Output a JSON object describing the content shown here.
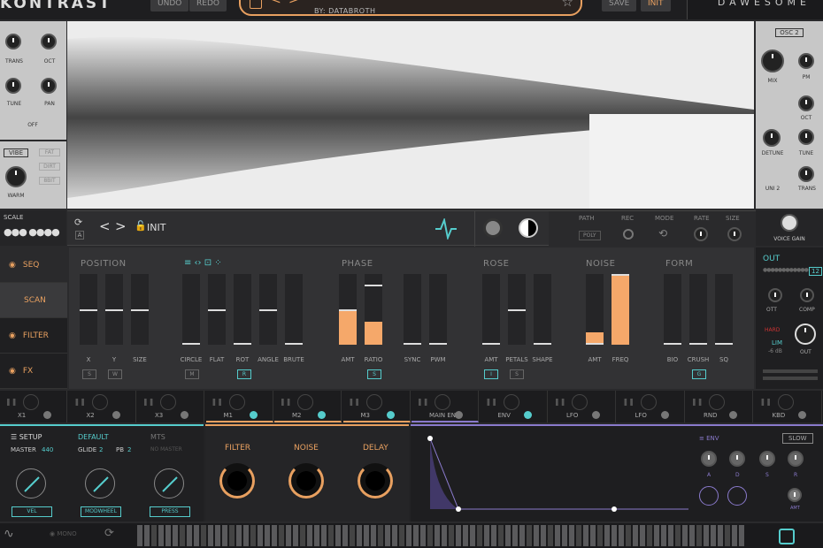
{
  "header": {
    "logo": "KONTRAST",
    "undo": "UNDO",
    "redo": "REDO",
    "preset_by": "BY: DATABROTH",
    "save": "SAVE",
    "init": "INIT",
    "brand": "DAWESOME"
  },
  "left_panel": {
    "trans": "TRANS",
    "oct": "OCT",
    "tune": "TUNE",
    "pan": "PAN",
    "off": "OFF",
    "vibe": "VIBE",
    "fat": "FAT",
    "dirt": "DIRT",
    "bbit": "8BIT",
    "warm": "WARM"
  },
  "right_panel": {
    "osc": "OSC 2",
    "mix": "MIX",
    "pm": "PM",
    "oct": "OCT",
    "detune": "DETUNE",
    "tune": "TUNE",
    "uni": "UNI 2",
    "trans": "TRANS"
  },
  "scale": {
    "label": "SCALE"
  },
  "midbar": {
    "preset": "INIT",
    "path": "PATH",
    "rec": "REC",
    "mode": "MODE",
    "rate": "RATE",
    "size": "SIZE",
    "poly": "POLY",
    "voice_gain": "VOICE GAIN",
    "a_label": "A"
  },
  "sidebar": {
    "seq": "SEQ",
    "scan": "SCAN",
    "filter": "FILTER",
    "fx": "FX"
  },
  "sections": {
    "position": "POSITION",
    "phase": "PHASE",
    "rose": "ROSE",
    "noise": "NOISE",
    "form": "FORM"
  },
  "sliders": [
    {
      "label": "X",
      "level": 0.5,
      "fill": 0
    },
    {
      "label": "Y",
      "level": 0.5,
      "fill": 0
    },
    {
      "label": "SIZE",
      "level": 0.5,
      "fill": 0
    },
    {
      "label": "CIRCLE",
      "level": 0,
      "fill": 0
    },
    {
      "label": "FLAT",
      "level": 0.5,
      "fill": 0
    },
    {
      "label": "ROT",
      "level": 0,
      "fill": 0
    },
    {
      "label": "ANGLE",
      "level": 0.5,
      "fill": 0
    },
    {
      "label": "BRUTE",
      "level": 0,
      "fill": 0
    },
    {
      "label": "AMT",
      "level": 0.5,
      "fill": 0.5
    },
    {
      "label": "RATIO",
      "level": 0.85,
      "fill": 0.33
    },
    {
      "label": "SYNC",
      "level": 0,
      "fill": 0
    },
    {
      "label": "PWM",
      "level": 0,
      "fill": 0
    },
    {
      "label": "AMT",
      "level": 0,
      "fill": 0
    },
    {
      "label": "PETALS",
      "level": 0.5,
      "fill": 0
    },
    {
      "label": "SHAPE",
      "level": 0,
      "fill": 0
    },
    {
      "label": "AMT",
      "level": 0,
      "fill": 0.17
    },
    {
      "label": "FREQ",
      "level": 1,
      "fill": 1
    },
    {
      "label": "BIO",
      "level": 0,
      "fill": 0
    },
    {
      "label": "CRUSH",
      "level": 0,
      "fill": 0
    },
    {
      "label": "SQ",
      "level": 0,
      "fill": 0
    }
  ],
  "small_buttons": {
    "s1": "S",
    "w": "W",
    "m": "M",
    "r": "R",
    "s2": "S",
    "i": "I",
    "s3": "S",
    "g": "G"
  },
  "out": {
    "title": "OUT",
    "ott": "OTT",
    "comp": "COMP",
    "hard": "HARD",
    "lim": "LIM",
    "db": "-6 dB",
    "out": "OUT",
    "count": "12"
  },
  "mods": [
    "X1",
    "X2",
    "X3",
    "M1",
    "M2",
    "M3",
    "MAIN ENV",
    "ENV",
    "LFO",
    "LFO",
    "RND",
    "KBD"
  ],
  "setup": {
    "title": "SETUP",
    "default": "DEFAULT",
    "mts": "MTS",
    "master": "MASTER",
    "master_val": "440",
    "glide": "GLIDE",
    "glide_val": "2",
    "pb": "PB",
    "pb_val": "2",
    "no_master": "NO MASTER",
    "vel": "VEL",
    "modwheel": "MODWHEEL",
    "press": "PRESS"
  },
  "fxknobs": {
    "filter": "FILTER",
    "noise": "NOISE",
    "delay": "DELAY"
  },
  "env": {
    "title": "ENV",
    "slow": "SLOW",
    "a": "A",
    "d": "D",
    "s": "S",
    "r": "R",
    "amt": "AMT"
  },
  "kbd": {
    "mono": "MONO"
  }
}
